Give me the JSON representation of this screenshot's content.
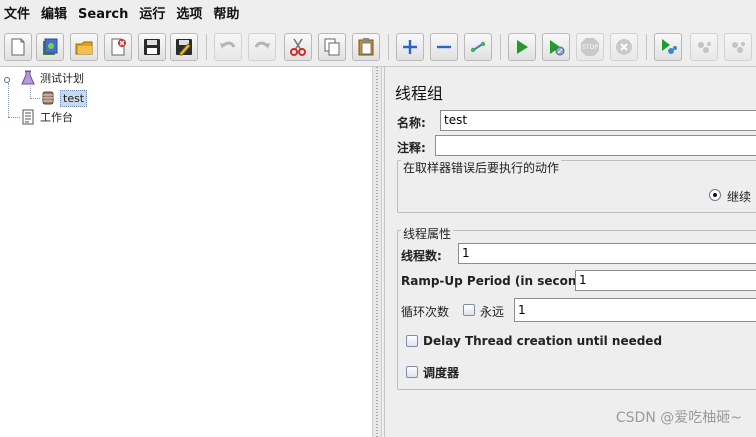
{
  "menu": {
    "items": [
      "文件",
      "编辑",
      "Search",
      "运行",
      "选项",
      "帮助"
    ]
  },
  "toolbar": {
    "buttons": [
      {
        "icon": "new-icon"
      },
      {
        "icon": "templates-icon"
      },
      {
        "icon": "open-icon"
      },
      {
        "icon": "close-icon"
      },
      {
        "icon": "save-icon"
      },
      {
        "icon": "save-as-icon"
      },
      {
        "icon": "undo-icon"
      },
      {
        "icon": "redo-icon"
      },
      {
        "icon": "cut-icon"
      },
      {
        "icon": "copy-icon"
      },
      {
        "icon": "paste-icon"
      },
      {
        "icon": "expand-icon"
      },
      {
        "icon": "collapse-icon"
      },
      {
        "icon": "toggle-icon"
      },
      {
        "icon": "start-icon"
      },
      {
        "icon": "start-no-pause-icon"
      },
      {
        "icon": "stop-icon"
      },
      {
        "icon": "shutdown-icon"
      },
      {
        "icon": "remote-start-icon"
      },
      {
        "icon": "remote-stop-icon"
      },
      {
        "icon": "remote-shutdown-icon"
      }
    ]
  },
  "tree": {
    "root": "测试计划",
    "child": "test",
    "workbench": "工作台"
  },
  "panel": {
    "title": "线程组",
    "name_label": "名称:",
    "name_value": "test",
    "comment_label": "注释:",
    "comment_value": "",
    "error_group_title": "在取样器错误后要执行的动作",
    "error_action_selected": "继续",
    "thread_props_title": "线程属性",
    "threads_label": "线程数:",
    "threads_value": "1",
    "rampup_label": "Ramp-Up Period (in seconds):",
    "rampup_value": "1",
    "loop_label": "循环次数",
    "forever_label": "永远",
    "loop_value": "1",
    "delay_label": "Delay Thread creation until needed",
    "scheduler_label": "调度器"
  },
  "watermark": "CSDN @爱吃柚砸~",
  "colors": {
    "selection": "#c8d9ef",
    "green_play": "#1f9d2a",
    "blue_plus": "#2a64c8",
    "red_cut": "#d22a2a"
  }
}
